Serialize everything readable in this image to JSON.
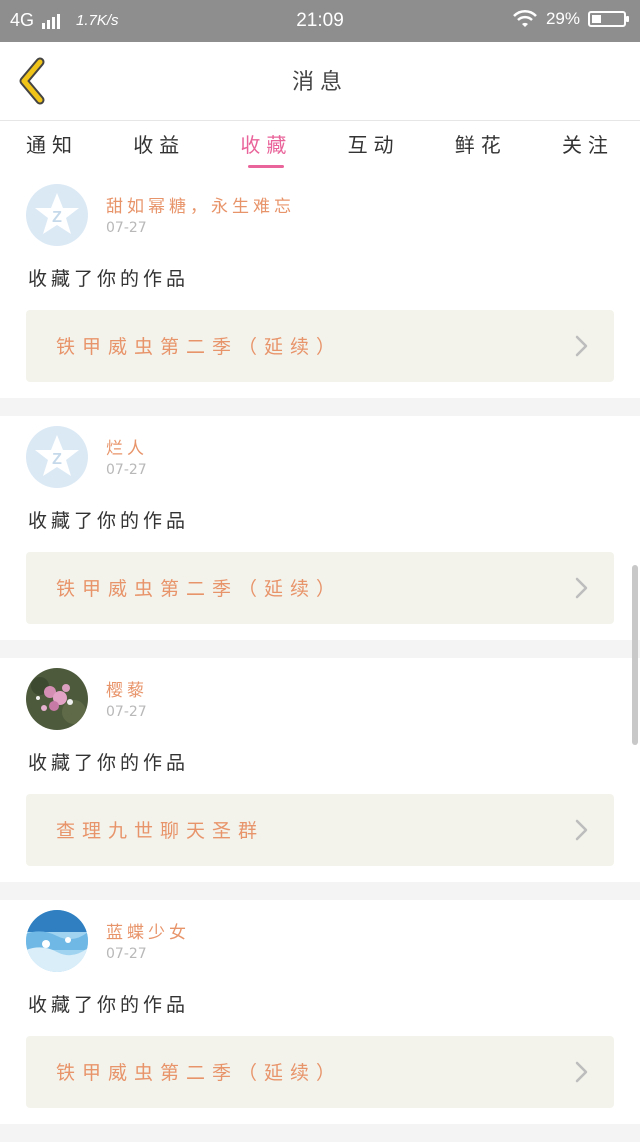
{
  "status_bar": {
    "network": "4G",
    "speed": "1.7K/s",
    "time": "21:09",
    "battery": "29%",
    "battery_level": 0.29
  },
  "header": {
    "title": "消息"
  },
  "tabs": [
    {
      "label": "通知",
      "active": false
    },
    {
      "label": "收益",
      "active": false
    },
    {
      "label": "收藏",
      "active": true
    },
    {
      "label": "互动",
      "active": false
    },
    {
      "label": "鲜花",
      "active": false
    },
    {
      "label": "关注",
      "active": false
    }
  ],
  "feed": [
    {
      "username": "甜如幂糖，永生难忘",
      "date": "07-27",
      "action": "收藏了你的作品",
      "work": "铁甲威虫第二季（延续）",
      "avatar": "default-avatar-icon"
    },
    {
      "username": "烂人",
      "date": "07-27",
      "action": "收藏了你的作品",
      "work": "铁甲威虫第二季（延续）",
      "avatar": "default-avatar-icon"
    },
    {
      "username": "樱藜",
      "date": "07-27",
      "action": "收藏了你的作品",
      "work": "查理九世聊天圣群",
      "avatar": "flower-photo-avatar"
    },
    {
      "username": "蓝蝶少女",
      "date": "07-27",
      "action": "收藏了你的作品",
      "work": "铁甲威虫第二季（延续）",
      "avatar": "water-photo-avatar"
    }
  ],
  "colors": {
    "accent": "#e9649a",
    "username": "#e8946a",
    "card_bg": "#f3f3ec",
    "back_arrow": "#f0c419"
  }
}
